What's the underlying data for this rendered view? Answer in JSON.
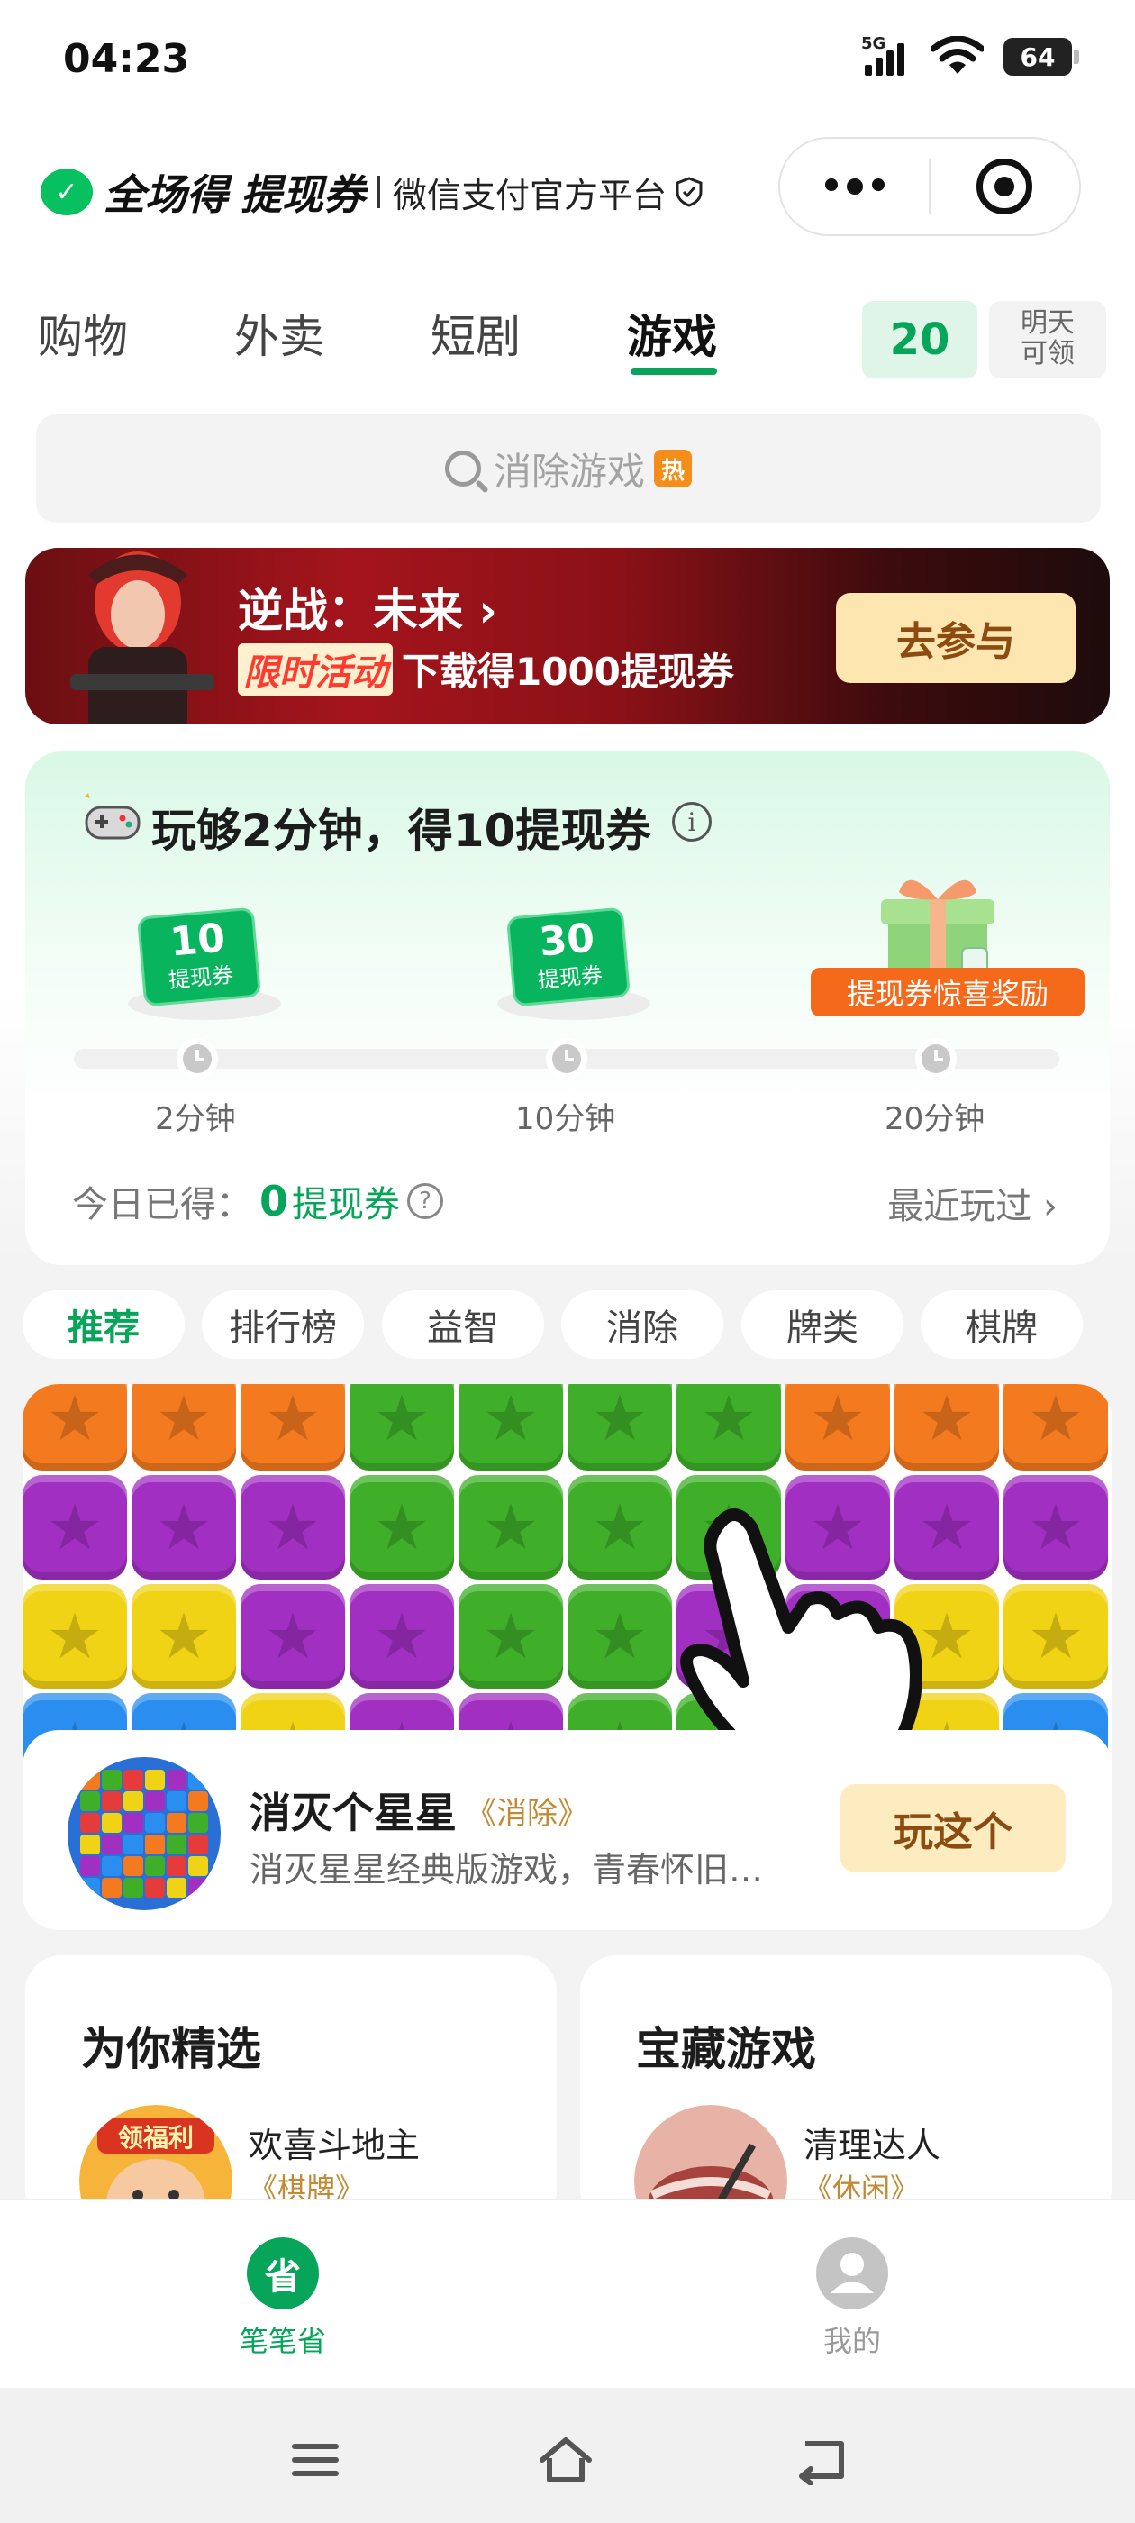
{
  "status_bar": {
    "time": "04:23",
    "network": "5G",
    "battery": "64"
  },
  "header": {
    "logo_part1": "全场得",
    "logo_part2": "提现券",
    "subtitle": "微信支付官方平台"
  },
  "tabs": [
    {
      "label": "购物"
    },
    {
      "label": "外卖"
    },
    {
      "label": "短剧"
    },
    {
      "label": "游戏",
      "active": true
    }
  ],
  "coin_count": "20",
  "tomorrow": {
    "line1": "明天",
    "line2": "可领"
  },
  "search": {
    "placeholder": "消除游戏",
    "badge": "热"
  },
  "banner": {
    "title": "逆战：未来",
    "title_chevron": "›",
    "limited": "限时活动",
    "subtitle": "下载得1000提现券",
    "button": "去参与"
  },
  "task": {
    "title": "玩够2分钟，得10提现券",
    "rewards": [
      {
        "amount": "10",
        "unit": "提现券"
      },
      {
        "amount": "30",
        "unit": "提现券"
      }
    ],
    "gift_label": "提现券惊喜奖励",
    "milestones": [
      "2分钟",
      "10分钟",
      "20分钟"
    ],
    "progress": 0,
    "earned_label": "今日已得：",
    "earned_value": "0",
    "earned_unit": "提现券",
    "recent": "最近玩过",
    "recent_chevron": "›"
  },
  "categories": [
    {
      "label": "推荐",
      "active": true
    },
    {
      "label": "排行榜"
    },
    {
      "label": "益智"
    },
    {
      "label": "消除"
    },
    {
      "label": "牌类"
    },
    {
      "label": "棋牌"
    }
  ],
  "featured": {
    "name": "消灭个星星",
    "tag": "《消除》",
    "desc": "消灭星星经典版游戏，青春怀旧…",
    "button": "玩这个"
  },
  "sections": [
    {
      "title": "为你精选",
      "game": "欢喜斗地主",
      "tag": "《棋牌》",
      "thumb_text": "领福利"
    },
    {
      "title": "宝藏游戏",
      "game": "清理达人",
      "tag": "《休闲》"
    }
  ],
  "bottom_nav": [
    {
      "label": "笔笔省",
      "icon_char": "省",
      "active": true
    },
    {
      "label": "我的"
    }
  ],
  "colors": {
    "brand_green": "#07c160",
    "accent_green": "#07a55a",
    "orange": "#f5691a",
    "gold": "#c28a35"
  }
}
